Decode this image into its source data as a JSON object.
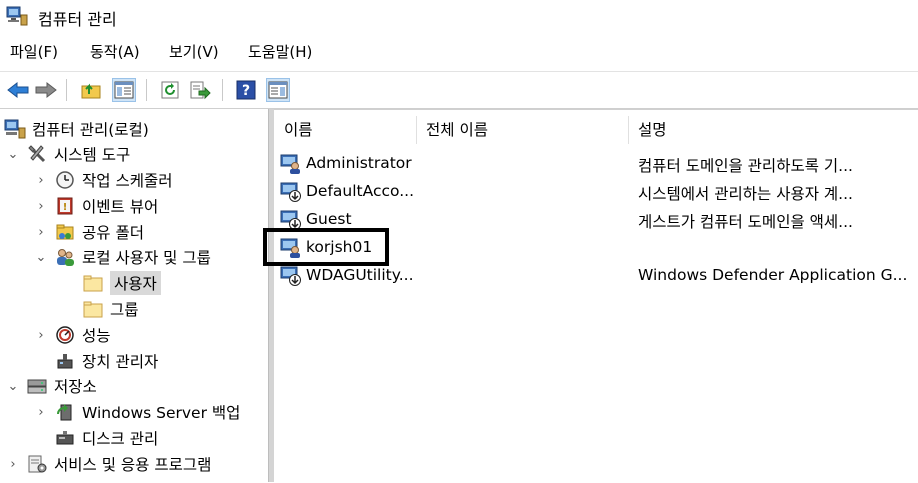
{
  "window": {
    "title": "컴퓨터 관리"
  },
  "menu": [
    "파일(F)",
    "동작(A)",
    "보기(V)",
    "도움말(H)"
  ],
  "toolbar": {
    "buttons": [
      "back-icon",
      "forward-icon",
      "up-folder-icon",
      "show-hide-tree-icon",
      "refresh-icon",
      "export-list-icon",
      "help-icon",
      "action-pane-icon"
    ]
  },
  "tree": [
    {
      "label": "컴퓨터 관리(로컬)",
      "icon": "computer-management-icon",
      "level": 0,
      "arrow": ""
    },
    {
      "label": "시스템 도구",
      "icon": "system-tools-icon",
      "level": 1,
      "arrow": "⌄"
    },
    {
      "label": "작업 스케줄러",
      "icon": "task-scheduler-icon",
      "level": 2,
      "arrow": "›"
    },
    {
      "label": "이벤트 뷰어",
      "icon": "event-viewer-icon",
      "level": 2,
      "arrow": "›"
    },
    {
      "label": "공유 폴더",
      "icon": "shared-folders-icon",
      "level": 2,
      "arrow": "›"
    },
    {
      "label": "로컬 사용자 및 그룹",
      "icon": "local-users-groups-icon",
      "level": 2,
      "arrow": "⌄"
    },
    {
      "label": "사용자",
      "icon": "folder-icon",
      "level": 3,
      "arrow": "",
      "selected": true
    },
    {
      "label": "그룹",
      "icon": "folder-icon",
      "level": 3,
      "arrow": ""
    },
    {
      "label": "성능",
      "icon": "performance-icon",
      "level": 2,
      "arrow": "›"
    },
    {
      "label": "장치 관리자",
      "icon": "device-manager-icon",
      "level": 2,
      "arrow": ""
    },
    {
      "label": "저장소",
      "icon": "storage-icon",
      "level": 1,
      "arrow": "⌄"
    },
    {
      "label": "Windows Server 백업",
      "icon": "server-backup-icon",
      "level": 2,
      "arrow": "›"
    },
    {
      "label": "디스크 관리",
      "icon": "disk-management-icon",
      "level": 2,
      "arrow": ""
    },
    {
      "label": "서비스 및 응용 프로그램",
      "icon": "services-applications-icon",
      "level": 1,
      "arrow": "›"
    }
  ],
  "list": {
    "columns": [
      "이름",
      "전체 이름",
      "설명"
    ],
    "rows": [
      {
        "name": "Administrator",
        "full_name": "",
        "description": "컴퓨터 도메인을 관리하도록 기..."
      },
      {
        "name": "DefaultAcco...",
        "full_name": "",
        "description": "시스템에서 관리하는 사용자 계..."
      },
      {
        "name": "Guest",
        "full_name": "",
        "description": "게스트가 컴퓨터 도메인을 액세..."
      },
      {
        "name": "korjsh01",
        "full_name": "",
        "description": ""
      },
      {
        "name": "WDAGUtility...",
        "full_name": "",
        "description": "Windows Defender Application G..."
      }
    ],
    "highlighted_row": "korjsh01"
  }
}
